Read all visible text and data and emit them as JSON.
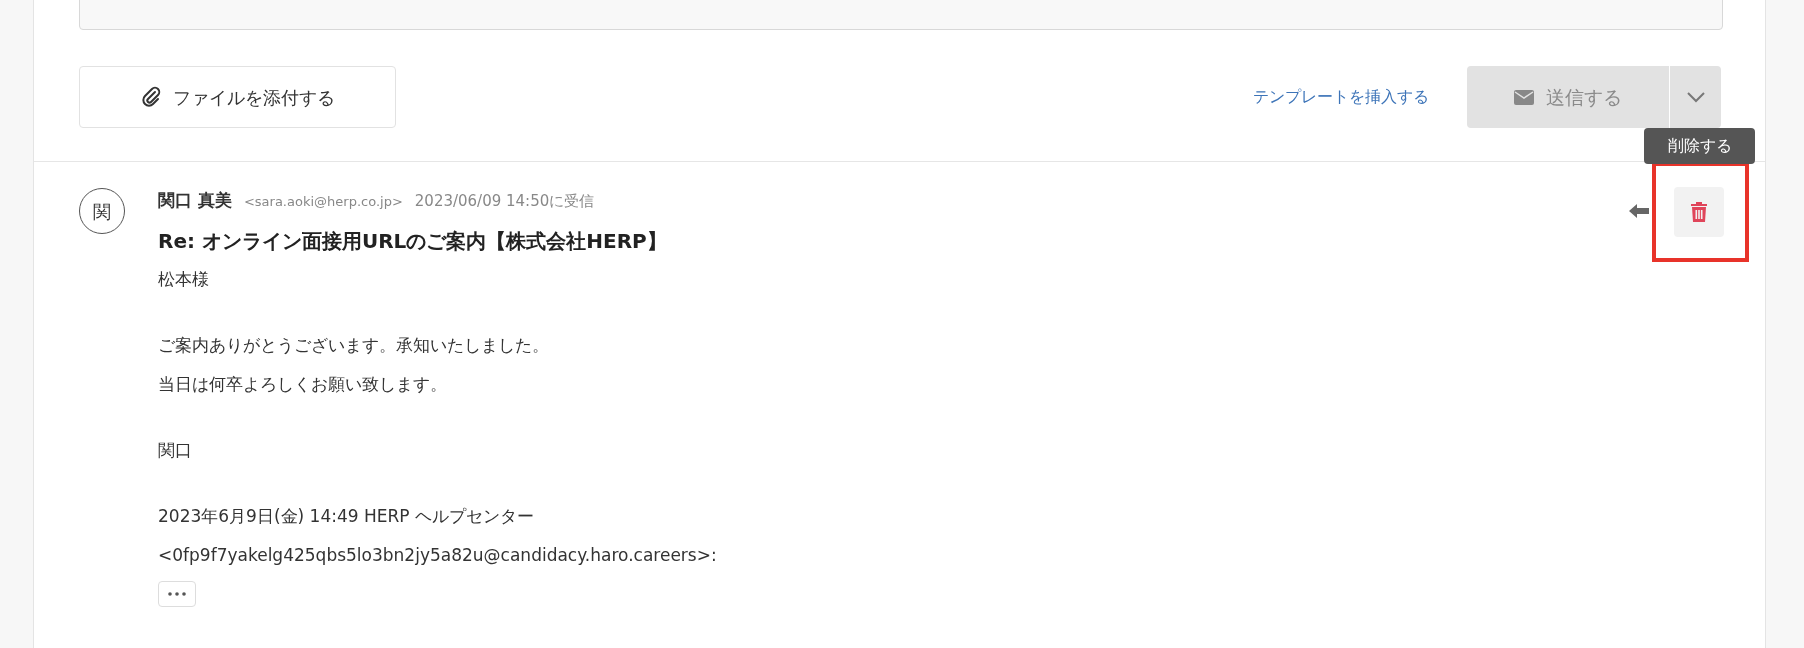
{
  "composer": {
    "attach_button": "ファイルを添付する",
    "template_link": "テンプレートを挿入する",
    "send_button": {
      "label": "送信する",
      "disabled": true
    }
  },
  "tooltip": "削除する",
  "message": {
    "avatar": "関",
    "sender_name": "関口 真美",
    "sender_email": "<sara.aoki@herp.co.jp>",
    "received": "2023/06/09 14:50に受信",
    "subject": "Re: オンライン面接用URLのご案内【株式会社HERP】",
    "body": [
      [
        "松本様"
      ],
      [
        "ご案内ありがとうございます。承知いたしました。",
        "当日は何卒よろしくお願い致します。"
      ],
      [
        "関口"
      ],
      [
        "2023年6月9日(金) 14:49 HERP ヘルプセンター",
        "<0fp9f7yakelg425qbs5lo3bn2jy5a82u@candidacy.haro.careers>:"
      ]
    ]
  }
}
